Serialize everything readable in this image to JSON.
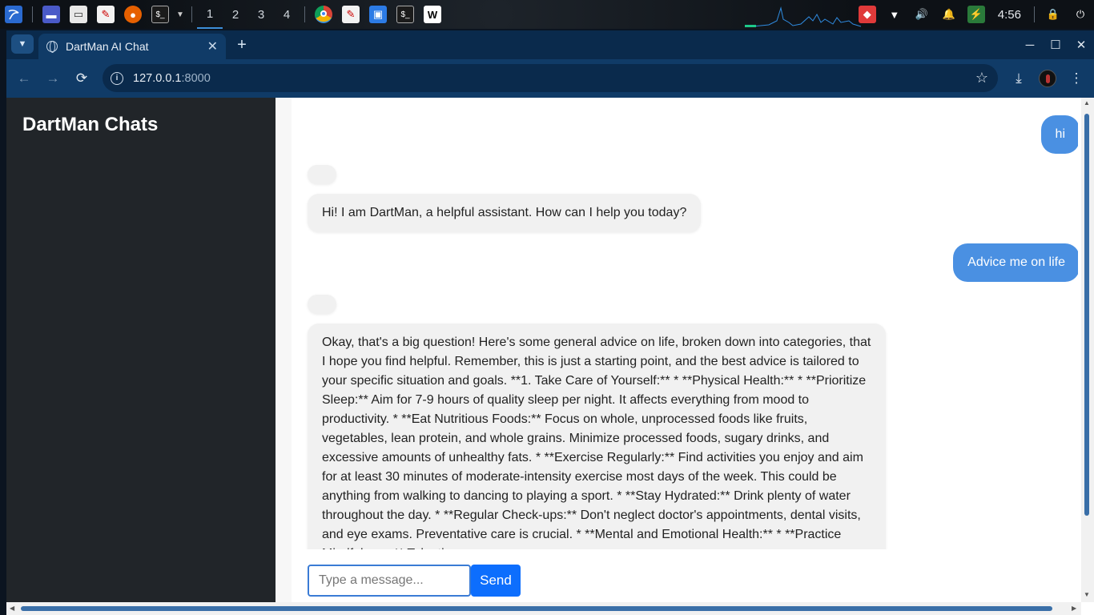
{
  "taskbar": {
    "workspaces": [
      "1",
      "2",
      "3",
      "4"
    ],
    "active_workspace": "1",
    "clock": "4:56",
    "icons": [
      "kali-menu-icon",
      "desktop-icon",
      "files-icon",
      "text-editor-icon",
      "firefox-icon",
      "terminal-icon",
      "chrome-icon",
      "editor-icon",
      "folder-icon",
      "terminal-icon",
      "app-icon"
    ],
    "tray_icons": [
      "vpn-icon",
      "wifi-icon",
      "volume-icon",
      "bell-icon",
      "battery-icon",
      "lock-icon",
      "power-icon"
    ]
  },
  "browser": {
    "tab_title": "DartMan AI Chat",
    "url_host": "127.0.0.1",
    "url_port": ":8000"
  },
  "sidebar": {
    "title": "DartMan Chats"
  },
  "chat": {
    "messages": [
      {
        "role": "user",
        "text": "hi"
      },
      {
        "role": "bot",
        "text": "Hi! I am DartMan, a helpful assistant. How can I help you today?"
      },
      {
        "role": "user",
        "text": "Advice me on life"
      },
      {
        "role": "bot",
        "text": "Okay, that's a big question! Here's some general advice on life, broken down into categories, that I hope you find helpful. Remember, this is just a starting point, and the best advice is tailored to your specific situation and goals. **1. Take Care of Yourself:** * **Physical Health:** * **Prioritize Sleep:** Aim for 7-9 hours of quality sleep per night. It affects everything from mood to productivity. * **Eat Nutritious Foods:** Focus on whole, unprocessed foods like fruits, vegetables, lean protein, and whole grains. Minimize processed foods, sugary drinks, and excessive amounts of unhealthy fats. * **Exercise Regularly:** Find activities you enjoy and aim for at least 30 minutes of moderate-intensity exercise most days of the week. This could be anything from walking to dancing to playing a sport. * **Stay Hydrated:** Drink plenty of water throughout the day. * **Regular Check-ups:** Don't neglect doctor's appointments, dental visits, and eye exams. Preventative care is crucial. * **Mental and Emotional Health:** * **Practice Mindfulness:** Take time"
      }
    ],
    "input_placeholder": "Type a message...",
    "send_label": "Send"
  },
  "colors": {
    "user_bubble": "#4a90e2",
    "bot_bubble": "#f1f1f1",
    "sidebar_bg": "#212529",
    "send_button": "#0d6efd",
    "browser_frame": "#103b67"
  }
}
